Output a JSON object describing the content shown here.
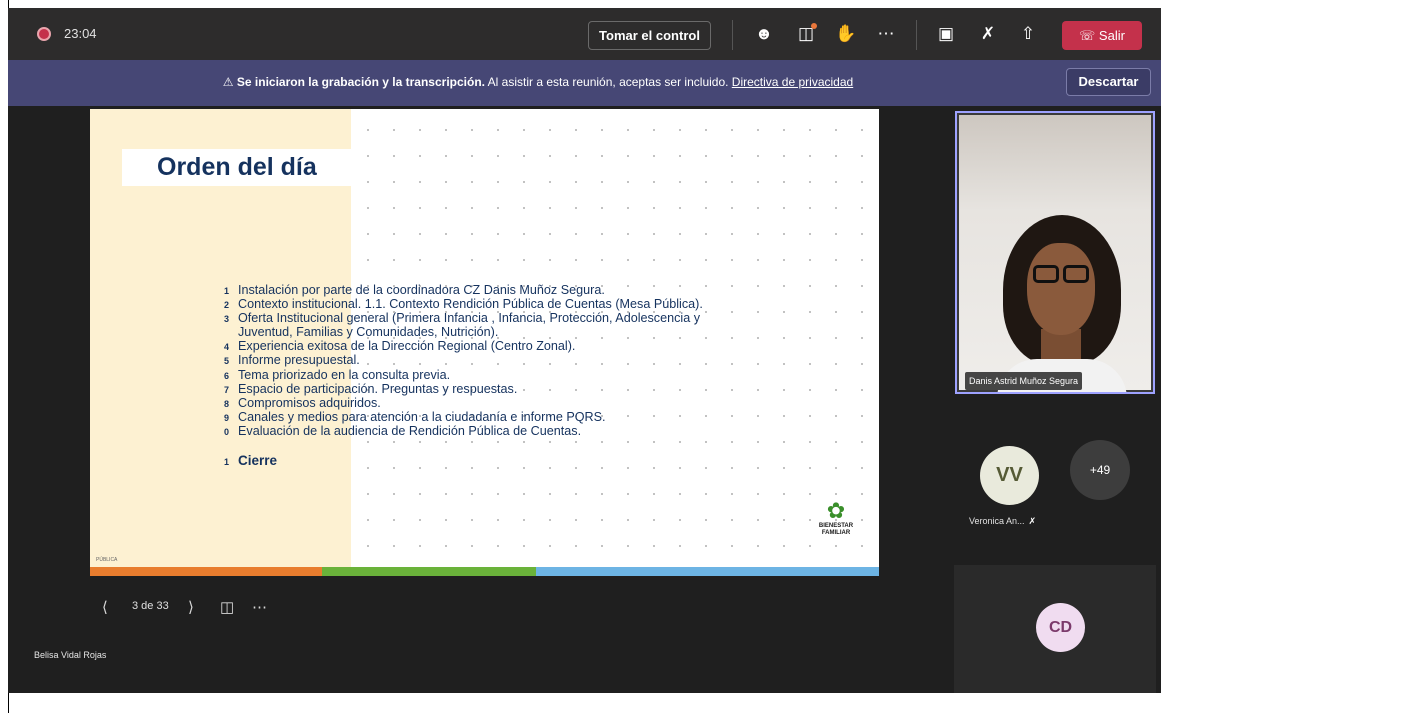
{
  "topbar": {
    "timer": "23:04",
    "take_control_label": "Tomar el control",
    "leave_label": "Salir"
  },
  "notice": {
    "bold_text": "Se iniciaron la grabación y la transcripción.",
    "text": " Al asistir a esta reunión, aceptas ser incluido. ",
    "link_text": "Directiva de privacidad",
    "dismiss_label": "Descartar"
  },
  "slide": {
    "title": "Orden del día",
    "items": [
      {
        "num": "1",
        "text": "Instalación por parte de la coordinadora CZ Danis Muñoz Segura."
      },
      {
        "num": "2",
        "text": "Contexto institucional. 1.1. Contexto Rendición Pública de Cuentas (Mesa Pública)."
      },
      {
        "num": "3",
        "text": "Oferta Institucional general (Primera Infancia , Infancia, Protección, Adolescencia y",
        "cont": "Juventud, Familias y Comunidades, Nutrición)."
      },
      {
        "num": "4",
        "text": "Experiencia exitosa de la Dirección Regional (Centro Zonal)."
      },
      {
        "num": "5",
        "text": "Informe presupuestal."
      },
      {
        "num": "6",
        "text": "Tema priorizado en la consulta previa."
      },
      {
        "num": "7",
        "text": "Espacio de participación. Preguntas y respuestas."
      },
      {
        "num": "8",
        "text": "Compromisos adquiridos."
      },
      {
        "num": "9",
        "text": "Canales y medios para atención a la ciudadanía e informe PQRS."
      },
      {
        "num": "0",
        "text": "Evaluación de la audiencia de Rendición Pública de Cuentas."
      }
    ],
    "closing": {
      "num": "1",
      "text": "Cierre"
    },
    "footer_text": "PÚBLICA",
    "logo_text_1": "BIENESTAR",
    "logo_text_2": "FAMILIAR"
  },
  "slide_controls": {
    "counter": "3 de 33"
  },
  "presenter_name": "Belisa Vidal Rojas",
  "participants": {
    "video_name": "Danis Astrid Muñoz Segura",
    "avatar_vv_initials": "VV",
    "avatar_vv_name": "Veronica An...",
    "more_count": "+49",
    "avatar_cd_initials": "CD"
  },
  "colors": {
    "accent": "#464775",
    "leave": "#c4314b",
    "strip_orange": "#e87d2e",
    "strip_green": "#6ab23a",
    "strip_blue": "#6db4e4"
  }
}
